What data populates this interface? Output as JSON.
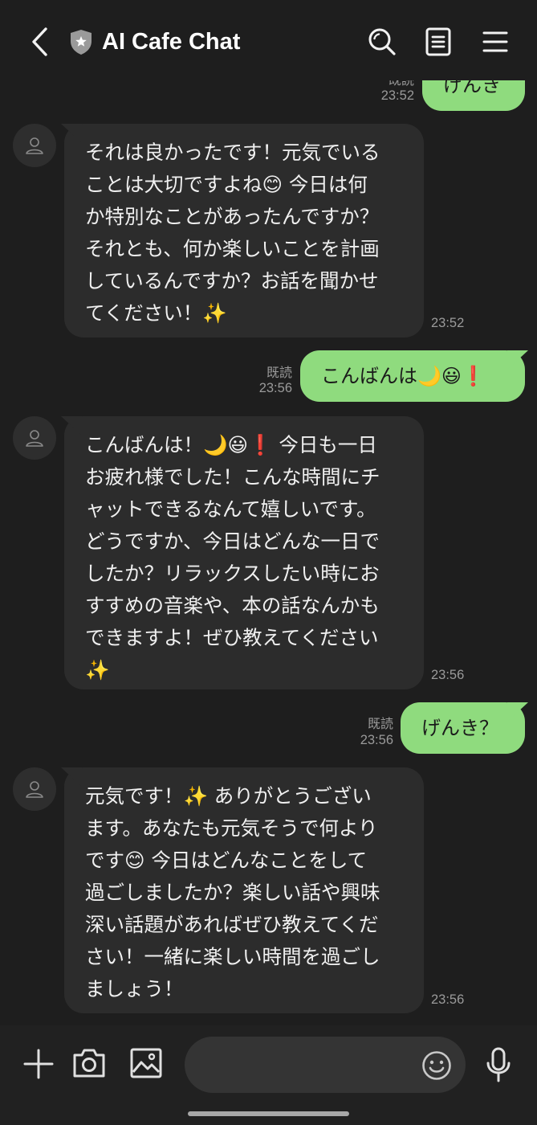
{
  "header": {
    "title": "AI Cafe Chat",
    "icons": [
      "back-arrow-icon",
      "shield-star-icon",
      "search-icon",
      "notes-icon",
      "menu-icon"
    ]
  },
  "messages": [
    {
      "sender": "me",
      "text": "げんき",
      "read": "既読",
      "time": "23:52"
    },
    {
      "sender": "bot",
      "lines": [
        "それは良かったです！元気でいる",
        "ことは大切ですよね😊 今日は何",
        "か特別なことがあったんですか？",
        "それとも、何か楽しいことを計画",
        "しているんですか？お話を聞かせ",
        "てください！✨"
      ],
      "time": "23:52"
    },
    {
      "sender": "me",
      "text": "こんばんは🌙😃❗",
      "read": "既読",
      "time": "23:56"
    },
    {
      "sender": "bot",
      "lines": [
        "こんばんは！🌙😃❗ 今日も一日",
        "お疲れ様でした！こんな時間にチ",
        "ャットできるなんて嬉しいです。",
        "どうですか、今日はどんな一日で",
        "したか？リラックスしたい時にお",
        "すすめの音楽や、本の話なんかも",
        "できますよ！ぜひ教えてください",
        "✨"
      ],
      "time": "23:56"
    },
    {
      "sender": "me",
      "text": "げんき？",
      "read": "既読",
      "time": "23:56"
    },
    {
      "sender": "bot",
      "lines": [
        "元気です！✨ ありがとうござい",
        "ます。あなたも元気そうで何より",
        "です😊 今日はどんなことをして",
        "過ごしましたか？楽しい話や興味",
        "深い話題があればぜひ教えてくだ",
        "さい！一緒に楽しい時間を過ごし",
        "ましょう！"
      ],
      "time": "23:56"
    }
  ],
  "composer": {
    "input_value": "",
    "icons": [
      "plus-icon",
      "camera-icon",
      "image-icon",
      "emoji-icon",
      "microphone-icon"
    ]
  },
  "colors": {
    "background": "#1e1e1e",
    "incoming_bubble": "#2c2c2c",
    "outgoing_bubble": "#8fdb7e",
    "meta_text": "#9a9a9a"
  }
}
